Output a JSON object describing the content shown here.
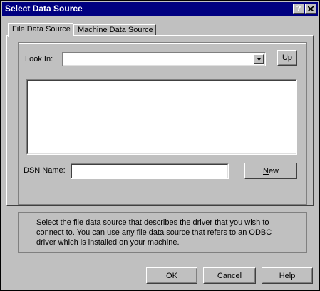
{
  "window": {
    "title": "Select Data Source",
    "help_button": "?",
    "close_icon": "close-icon"
  },
  "tabs": [
    {
      "label": "File Data Source",
      "active": true
    },
    {
      "label": "Machine Data Source",
      "active": false
    }
  ],
  "file_tab": {
    "look_in_label": "Look In:",
    "look_in_value": "",
    "up_button": "Up",
    "dsn_name_label": "DSN Name:",
    "dsn_name_value": "",
    "new_button": "New",
    "file_list": []
  },
  "description": "Select the file data source that describes the driver that you wish to connect to.   You can use any file data source that refers to an ODBC driver which is installed on your machine.",
  "footer": {
    "ok_label": "OK",
    "cancel_label": "Cancel",
    "help_label": "Help"
  }
}
